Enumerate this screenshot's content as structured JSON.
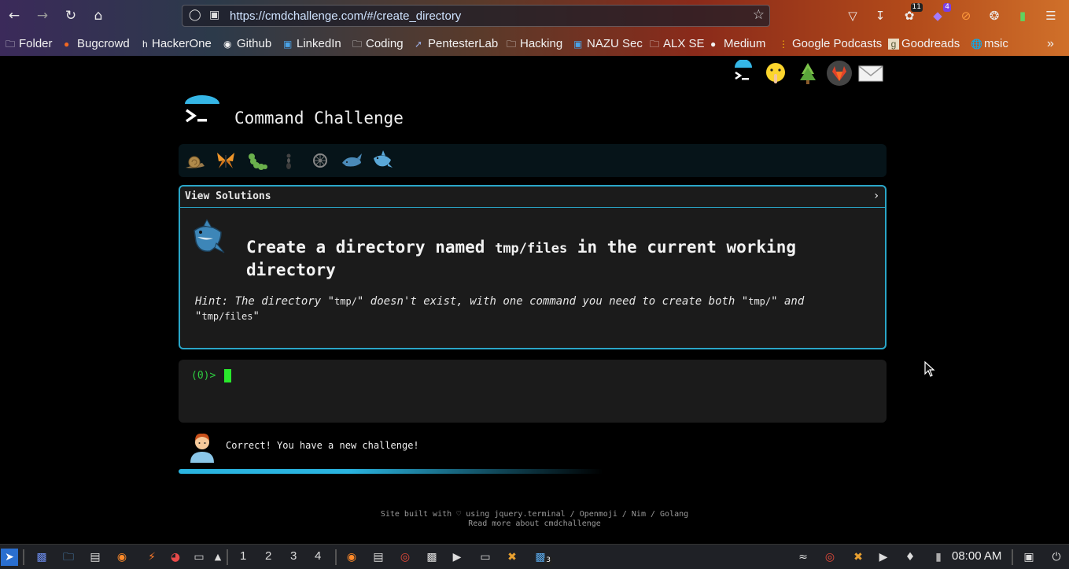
{
  "browser": {
    "url": "https://cmdchallenge.com/#/create_directory",
    "badges": {
      "extension_a": "11",
      "extension_b": "4"
    }
  },
  "bookmarks": [
    {
      "label": "Folder",
      "icon": "folder-icon"
    },
    {
      "label": "Bugcrowd",
      "icon": "bugcrowd-icon"
    },
    {
      "label": "HackerOne",
      "icon": "hackerone-icon"
    },
    {
      "label": "Github",
      "icon": "github-icon"
    },
    {
      "label": "LinkedIn",
      "icon": "linkedin-icon"
    },
    {
      "label": "Coding",
      "icon": "folder-icon"
    },
    {
      "label": "PentesterLab",
      "icon": "pentesterlab-icon"
    },
    {
      "label": "Hacking",
      "icon": "folder-icon"
    },
    {
      "label": "NAZU Sec",
      "icon": "linkedin-icon"
    },
    {
      "label": "ALX SE",
      "icon": "folder-icon"
    },
    {
      "label": "Medium",
      "icon": "medium-icon"
    },
    {
      "label": "Google Podcasts",
      "icon": "podcasts-icon"
    },
    {
      "label": "Goodreads",
      "icon": "goodreads-icon"
    },
    {
      "label": "msic",
      "icon": "globe-icon"
    }
  ],
  "site": {
    "title": "Command Challenge",
    "solutions_label": "View Solutions",
    "solutions_chevron": "›",
    "task_prefix": "Create a directory named ",
    "task_code": "tmp/files",
    "task_suffix": " in the current working directory",
    "hint_prefix": "Hint: The directory \"",
    "hint_code1": "tmp/",
    "hint_mid": "\" doesn't exist, with one command you need to create both \"",
    "hint_code2": "tmp/",
    "hint_and": "\" and \"",
    "hint_code3": "tmp/files",
    "hint_end": "\"",
    "prompt": "(0)> ",
    "message": "Correct! You have a new challenge!",
    "progress_fraction": 0.6,
    "footer_line1": "Site built with ♡ using jquery.terminal / Openmoji / Nim / Golang",
    "footer_line2": "Read more about cmdchallenge"
  },
  "taskbar": {
    "workspaces": [
      "1",
      "2",
      "3",
      "4"
    ],
    "clock": "08:00 AM",
    "window_badge": "3"
  },
  "colors": {
    "accent": "#2aa6c8",
    "prompt": "#2ecc40",
    "cursor": "#29e82c"
  }
}
